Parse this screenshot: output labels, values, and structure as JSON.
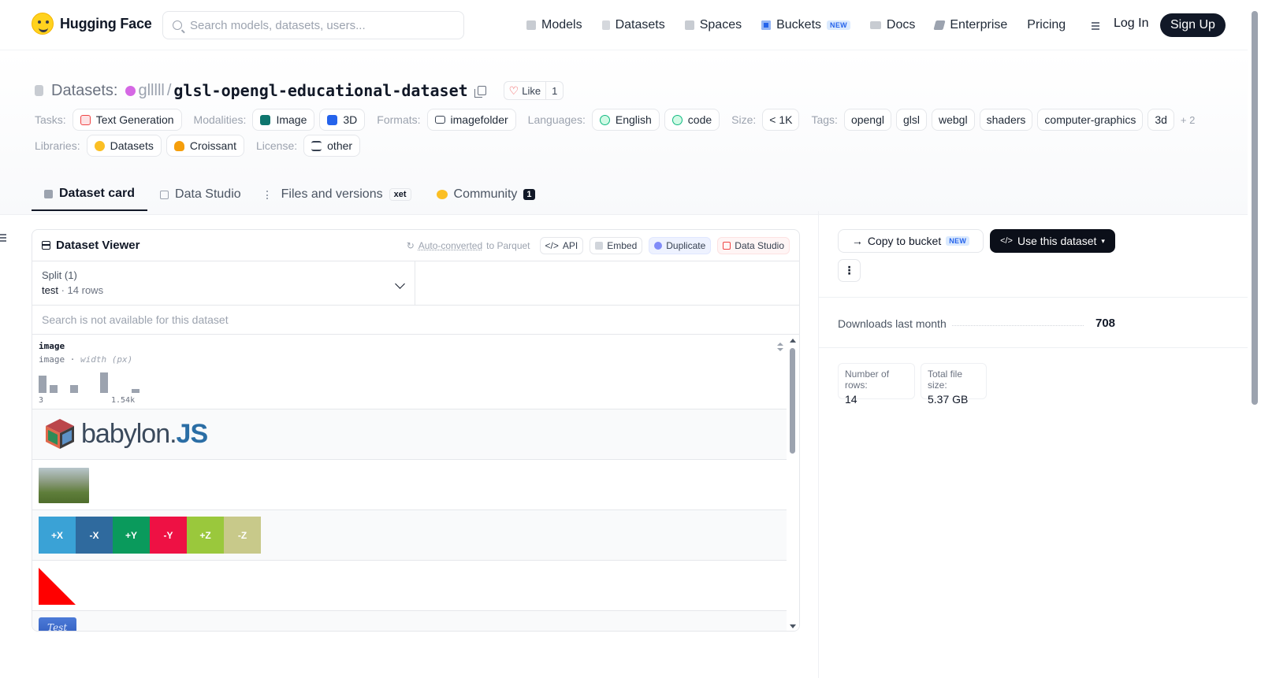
{
  "nav": {
    "logo_text": "Hugging Face",
    "search_placeholder": "Search models, datasets, users...",
    "links": [
      {
        "label": "Models",
        "color": "#9ca3af"
      },
      {
        "label": "Datasets",
        "color": "#c8ccd2"
      },
      {
        "label": "Spaces",
        "color": "#9ca3af"
      },
      {
        "label": "Buckets",
        "color": "#2563eb",
        "badge": "NEW"
      },
      {
        "label": "Docs",
        "color": "#9ca3af"
      },
      {
        "label": "Enterprise",
        "color": "#6b7280"
      },
      {
        "label": "Pricing"
      }
    ],
    "login": "Log In",
    "signup": "Sign Up"
  },
  "repo": {
    "prefix": "Datasets:",
    "user": "glllll",
    "separator": "/",
    "name": "glsl-opengl-educational-dataset",
    "like_label": "Like",
    "like_count": "1"
  },
  "meta": {
    "tasks_label": "Tasks:",
    "tasks": [
      "Text Generation"
    ],
    "modalities_label": "Modalities:",
    "modalities": [
      "Image",
      "3D"
    ],
    "formats_label": "Formats:",
    "formats": [
      "imagefolder"
    ],
    "languages_label": "Languages:",
    "languages": [
      "English",
      "code"
    ],
    "size_label": "Size:",
    "size": "< 1K",
    "tags_label": "Tags:",
    "tags": [
      "opengl",
      "glsl",
      "webgl",
      "shaders",
      "computer-graphics",
      "3d"
    ],
    "tags_more": "+ 2",
    "libraries_label": "Libraries:",
    "libraries": [
      "Datasets",
      "Croissant"
    ],
    "license_label": "License:",
    "license": "other"
  },
  "tabs": [
    {
      "label": "Dataset card",
      "active": true
    },
    {
      "label": "Data Studio"
    },
    {
      "label": "Files and versions",
      "badge": "xet"
    },
    {
      "label": "Community",
      "count": "1"
    }
  ],
  "viewer": {
    "title": "Dataset Viewer",
    "auto_converted": "Auto-converted",
    "to_parquet": "to Parquet",
    "api": "API",
    "embed": "Embed",
    "duplicate": "Duplicate",
    "data_studio": "Data Studio",
    "split_label": "Split (1)",
    "split_name": "test",
    "split_rows": "14 rows",
    "search_na": "Search is not available for this dataset",
    "column": {
      "name": "image",
      "type": "image",
      "stat": "width (px)",
      "hist_min": "3",
      "hist_max": "1.54k",
      "hist_values": [
        22,
        10,
        10,
        26,
        5
      ]
    },
    "rows": {
      "babylon_text": "babylon.",
      "babylon_js": "JS",
      "cube_faces": [
        {
          "label": "+X",
          "color": "#3aa2d6"
        },
        {
          "label": "-X",
          "color": "#2f6a9e"
        },
        {
          "label": "+Y",
          "color": "#0a9a5c"
        },
        {
          "label": "-Y",
          "color": "#ee1144"
        },
        {
          "label": "+Z",
          "color": "#9ac83c"
        },
        {
          "label": "-Z",
          "color": "#c8c98a"
        }
      ],
      "test_text": "Test"
    }
  },
  "sidebar": {
    "copy_bucket": "Copy to bucket",
    "copy_badge": "NEW",
    "use_dataset": "Use this dataset",
    "downloads_label": "Downloads last month",
    "downloads_value": "708",
    "rows_label": "Number of rows:",
    "rows_value": "14",
    "size_label": "Total file size:",
    "size_value": "5.37 GB"
  }
}
